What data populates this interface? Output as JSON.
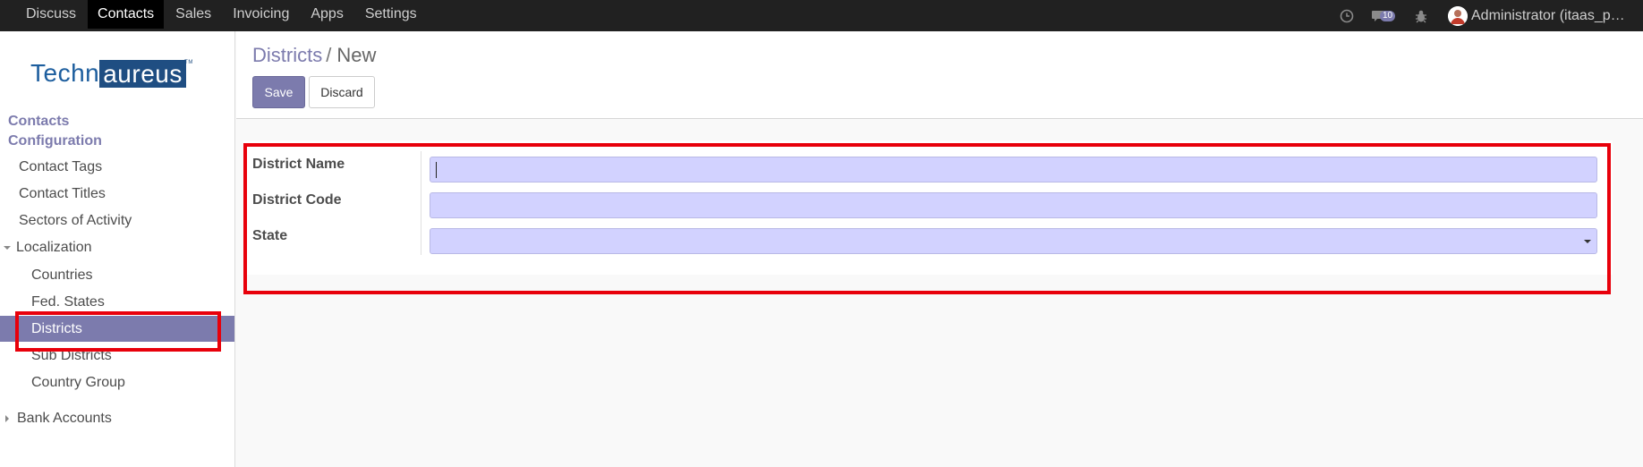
{
  "topbar": {
    "menu": [
      {
        "label": "Discuss"
      },
      {
        "label": "Contacts"
      },
      {
        "label": "Sales"
      },
      {
        "label": "Invoicing"
      },
      {
        "label": "Apps"
      },
      {
        "label": "Settings"
      }
    ],
    "active_menu": "Contacts",
    "chat_count": "10",
    "user_name": "Administrator (itaas_pa…"
  },
  "sidebar": {
    "logo": {
      "part1": "Techn",
      "part2": "aureus",
      "tm": "TM"
    },
    "section_contacts": "Contacts",
    "section_configuration": "Configuration",
    "items": {
      "contact_tags": "Contact Tags",
      "contact_titles": "Contact Titles",
      "sectors": "Sectors of Activity",
      "localization": "Localization",
      "countries": "Countries",
      "fed_states": "Fed. States",
      "districts": "Districts",
      "sub_districts": "Sub Districts",
      "country_group": "Country Group",
      "bank_accounts": "Bank Accounts"
    },
    "active_item": "Districts"
  },
  "control_panel": {
    "breadcrumb_parent": "Districts",
    "breadcrumb_separator": "/",
    "breadcrumb_current": "New",
    "save_label": "Save",
    "discard_label": "Discard"
  },
  "form": {
    "district_name_label": "District Name",
    "district_name_value": "",
    "district_code_label": "District Code",
    "district_code_value": "",
    "state_label": "State",
    "state_value": ""
  },
  "colors": {
    "accent": "#7c7bad",
    "topbar": "#212121",
    "input_required_bg": "#d2d2ff",
    "annotation": "#e8000b"
  },
  "icons": [
    "clock-icon",
    "chat-icon",
    "bug-icon",
    "avatar",
    "caret-down-icon",
    "caret-right-icon",
    "select-caret-icon"
  ]
}
